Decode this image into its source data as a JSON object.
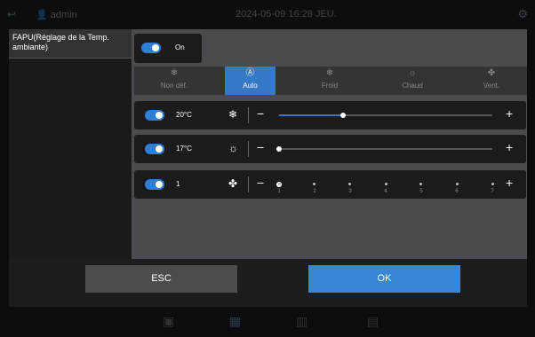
{
  "background": {
    "user": "admin",
    "datetime": "2024-05-09 16:28 JEU.",
    "bottom_icons": [
      "cube-icon",
      "list-icon",
      "calendar-icon",
      "document-icon"
    ]
  },
  "dialog": {
    "title": "FAPU(Réglage de la Temp. ambiante)",
    "power": {
      "label": "On",
      "on": true
    },
    "modes": [
      {
        "label": "Non déf.",
        "icon": "snow-sun-icon",
        "active": false
      },
      {
        "label": "Auto",
        "icon": "auto-icon",
        "active": true
      },
      {
        "label": "Froid",
        "icon": "snowflake-icon",
        "active": false
      },
      {
        "label": "Chaud",
        "icon": "sun-icon",
        "active": false
      },
      {
        "label": "Vent.",
        "icon": "fan-icon",
        "active": false
      }
    ],
    "rows": [
      {
        "value": "20°C",
        "icon": "snowflake-icon",
        "level": 0.3,
        "on": true
      },
      {
        "value": "17°C",
        "icon": "sun-icon",
        "level": 0.0,
        "on": true
      },
      {
        "value": "1",
        "icon": "fan-icon",
        "level": 0.0,
        "on": true,
        "ticks": [
          "1",
          "2",
          "3",
          "4",
          "5",
          "6",
          "7"
        ]
      }
    ],
    "minus": "−",
    "plus": "+"
  },
  "buttons": {
    "esc": "ESC",
    "ok": "OK"
  },
  "colors": {
    "accent": "#3478c7",
    "ok": "#3a86d6"
  }
}
